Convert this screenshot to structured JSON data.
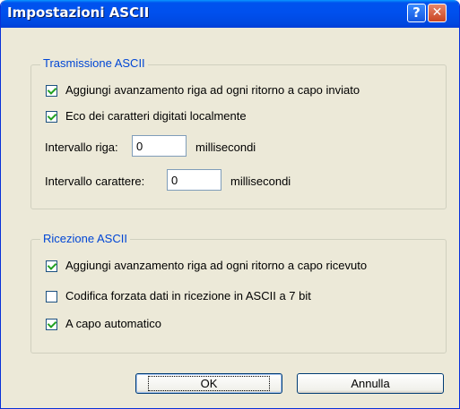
{
  "window": {
    "title": "Impostazioni ASCII"
  },
  "titlebar_buttons": {
    "help": "?",
    "close": "✕"
  },
  "send_group": {
    "legend": "Trasmissione ASCII",
    "add_line_feed": {
      "label": "Aggiungi avanzamento riga ad ogni ritorno a capo inviato",
      "checked": true
    },
    "local_echo": {
      "label": "Eco dei caratteri digitati localmente",
      "checked": true
    },
    "line_delay": {
      "label": "Intervallo riga:",
      "value": "0",
      "unit": "millisecondi"
    },
    "char_delay": {
      "label": "Intervallo carattere:",
      "value": "0",
      "unit": "millisecondi"
    }
  },
  "receive_group": {
    "legend": "Ricezione ASCII",
    "add_line_feed": {
      "label": "Aggiungi avanzamento riga ad ogni ritorno a capo ricevuto",
      "checked": true
    },
    "force_7bit": {
      "label": "Codifica forzata dati in ricezione in ASCII a 7 bit",
      "checked": false
    },
    "wrap": {
      "label": "A capo automatico",
      "checked": true
    }
  },
  "buttons": {
    "ok": "OK",
    "cancel": "Annulla"
  },
  "colors": {
    "title_bar": "#0054e3",
    "legend_text": "#0046d5",
    "dialog_bg": "#ece9d8",
    "check_mark": "#21a121"
  }
}
